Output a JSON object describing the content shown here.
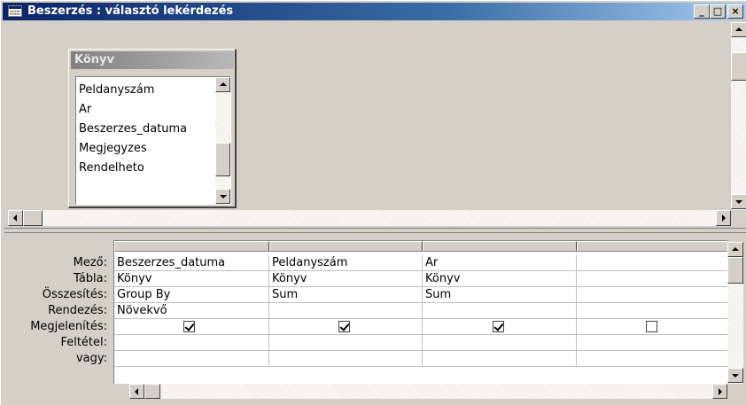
{
  "window": {
    "title": "Beszerzés : választó lekérdezés",
    "caption_buttons": {
      "minimize": "_",
      "maximize": "□",
      "close": "×"
    }
  },
  "upper": {
    "table": {
      "caption": "Könyv",
      "fields": [
        "Peldanyszám",
        "Ar",
        "Beszerzes_datuma",
        "Megjegyzes",
        "Rendelheto"
      ]
    }
  },
  "grid": {
    "row_labels": [
      "Mező:",
      "Tábla:",
      "Összesítés:",
      "Rendezés:",
      "Megjelenítés:",
      "Feltétel:",
      "vagy:"
    ],
    "columns": [
      {
        "field": "Beszerzes_datuma",
        "table": "Könyv",
        "total": "Group By",
        "sort": "Növekvő",
        "show": true,
        "criteria": "",
        "or": ""
      },
      {
        "field": "Peldanyszám",
        "table": "Könyv",
        "total": "Sum",
        "sort": "",
        "show": true,
        "criteria": "",
        "or": ""
      },
      {
        "field": "Ar",
        "table": "Könyv",
        "total": "Sum",
        "sort": "",
        "show": true,
        "criteria": "",
        "or": ""
      },
      {
        "field": "",
        "table": "",
        "total": "",
        "sort": "",
        "show": false,
        "criteria": "",
        "or": ""
      }
    ]
  },
  "colors": {
    "title_active": "#0a246a",
    "face": "#d4d0c8",
    "inactive_caption": "#808080"
  }
}
